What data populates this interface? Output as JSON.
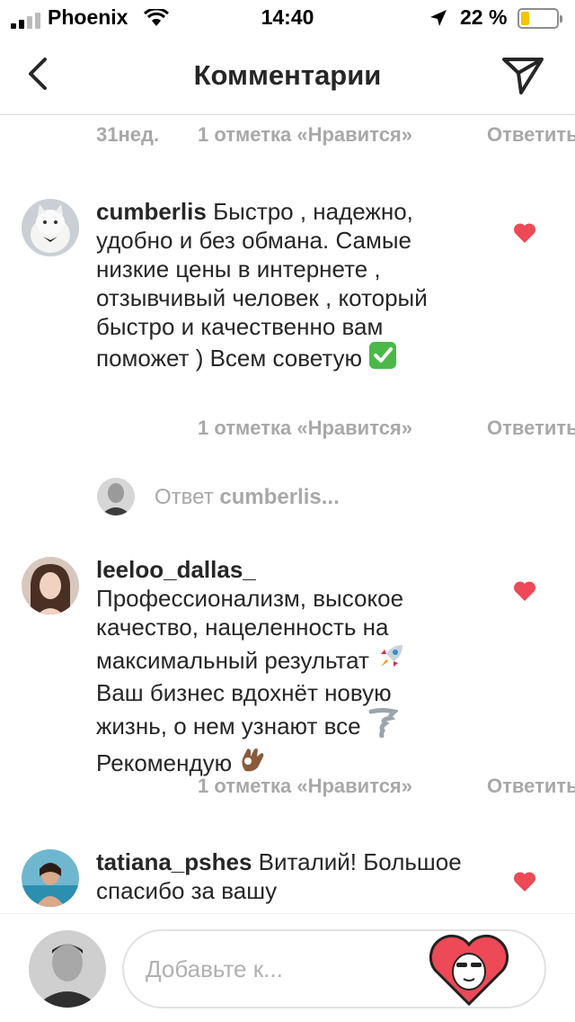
{
  "status": {
    "carrier": "Phoenix",
    "time": "14:40",
    "battery": "22 %",
    "battery_level": 0.22,
    "battery_color": "#f5c400"
  },
  "header": {
    "title": "Комментарии",
    "back_icon": "chevron-left-icon",
    "send_icon": "paper-plane-icon"
  },
  "top_meta": {
    "time": "31нед.",
    "likes": "1 отметка «Нравится»",
    "reply": "Ответить"
  },
  "comments": [
    {
      "username": "cumberlis",
      "text": "Быстро , надежно, удобно и без обмана. Самые низкие цены в интернете , отзывчивый человек , который быстро и качественно вам поможет ) Всем советую",
      "emoji": "✅",
      "likes": "1 отметка «Нравится»",
      "reply": "Ответить",
      "liked": true
    },
    {
      "username": "leeloo_dallas_",
      "lines": [
        "Профессионализм, высокое",
        "качество, нацеленность на",
        "максимальный результат",
        "Ваш бизнес вдохнёт новую",
        "жизнь, о нем узнают все",
        "Рекомендую"
      ],
      "emojis": [
        "🚀",
        "🌪",
        "👌🏾"
      ],
      "likes": "1 отметка «Нравится»",
      "reply": "Ответить",
      "liked": true
    },
    {
      "username": "tatiana_pshes",
      "text": "Виталий! Большое спасибо за вашу",
      "liked": true
    }
  ],
  "reply_thread": {
    "label": "Ответ",
    "to": "cumberlis..."
  },
  "input": {
    "placeholder": "Добавьте к..."
  },
  "colors": {
    "heart": "#ed4956",
    "muted": "#a8a8a8",
    "text": "#262626",
    "divider": "#dbdbdb"
  }
}
